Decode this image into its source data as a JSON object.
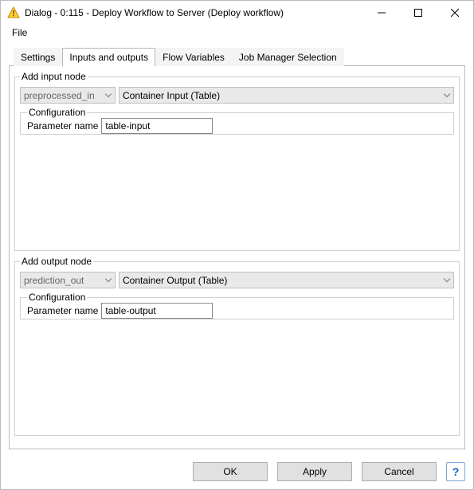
{
  "window": {
    "title": "Dialog - 0:115 - Deploy Workflow to Server (Deploy  workflow)"
  },
  "menu": {
    "file": "File"
  },
  "tabs": {
    "settings": "Settings",
    "io": "Inputs and outputs",
    "flowvars": "Flow Variables",
    "jobmgr": "Job Manager Selection"
  },
  "input_section": {
    "legend": "Add input node",
    "node_select_value": "preprocessed_in",
    "container_type": "Container Input (Table)",
    "config_legend": "Configuration",
    "param_label": "Parameter name",
    "param_value": "table-input"
  },
  "output_section": {
    "legend": "Add output node",
    "node_select_value": "prediction_out",
    "container_type": "Container Output (Table)",
    "config_legend": "Configuration",
    "param_label": "Parameter name",
    "param_value": "table-output"
  },
  "buttons": {
    "ok": "OK",
    "apply": "Apply",
    "cancel": "Cancel",
    "help": "?"
  }
}
